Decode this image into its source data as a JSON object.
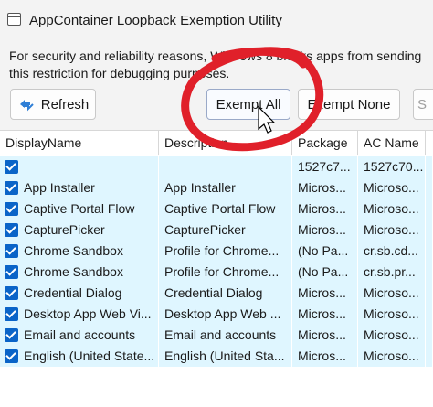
{
  "window": {
    "title": "AppContainer Loopback Exemption Utility"
  },
  "notice": {
    "line1": "For security and reliability reasons, Windows 8 blocks apps from sending",
    "line2": "this restriction for debugging purposes."
  },
  "toolbar": {
    "refresh_label": "Refresh",
    "exempt_all_label": "Exempt All",
    "exempt_none_label": "Exempt None",
    "save_label": "S"
  },
  "table": {
    "columns": [
      "DisplayName",
      "Description",
      "Package",
      "AC Name"
    ],
    "rows": [
      {
        "checked": true,
        "name": "",
        "description": "",
        "package": "1527c7...",
        "ac_name": "1527c70..."
      },
      {
        "checked": true,
        "name": "App Installer",
        "description": "App Installer",
        "package": "Micros...",
        "ac_name": "Microso..."
      },
      {
        "checked": true,
        "name": "Captive Portal Flow",
        "description": "Captive Portal Flow",
        "package": "Micros...",
        "ac_name": "Microso..."
      },
      {
        "checked": true,
        "name": "CapturePicker",
        "description": "CapturePicker",
        "package": "Micros...",
        "ac_name": "Microso..."
      },
      {
        "checked": true,
        "name": "Chrome Sandbox",
        "description": "Profile for Chrome...",
        "package": "(No Pa...",
        "ac_name": "cr.sb.cd..."
      },
      {
        "checked": true,
        "name": "Chrome Sandbox",
        "description": "Profile for Chrome...",
        "package": "(No Pa...",
        "ac_name": "cr.sb.pr..."
      },
      {
        "checked": true,
        "name": "Credential Dialog",
        "description": "Credential Dialog",
        "package": "Micros...",
        "ac_name": "Microso..."
      },
      {
        "checked": true,
        "name": "Desktop App Web Vi...",
        "description": "Desktop App Web ...",
        "package": "Micros...",
        "ac_name": "Microso..."
      },
      {
        "checked": true,
        "name": "Email and accounts",
        "description": "Email and accounts",
        "package": "Micros...",
        "ac_name": "Microso..."
      },
      {
        "checked": true,
        "name": "English (United State...",
        "description": "English (United Sta...",
        "package": "Micros...",
        "ac_name": "Microso..."
      }
    ]
  },
  "colors": {
    "row_bg": "#dff6ff",
    "checkbox": "#0a64c8",
    "annotation_circle": "#e0202a"
  }
}
